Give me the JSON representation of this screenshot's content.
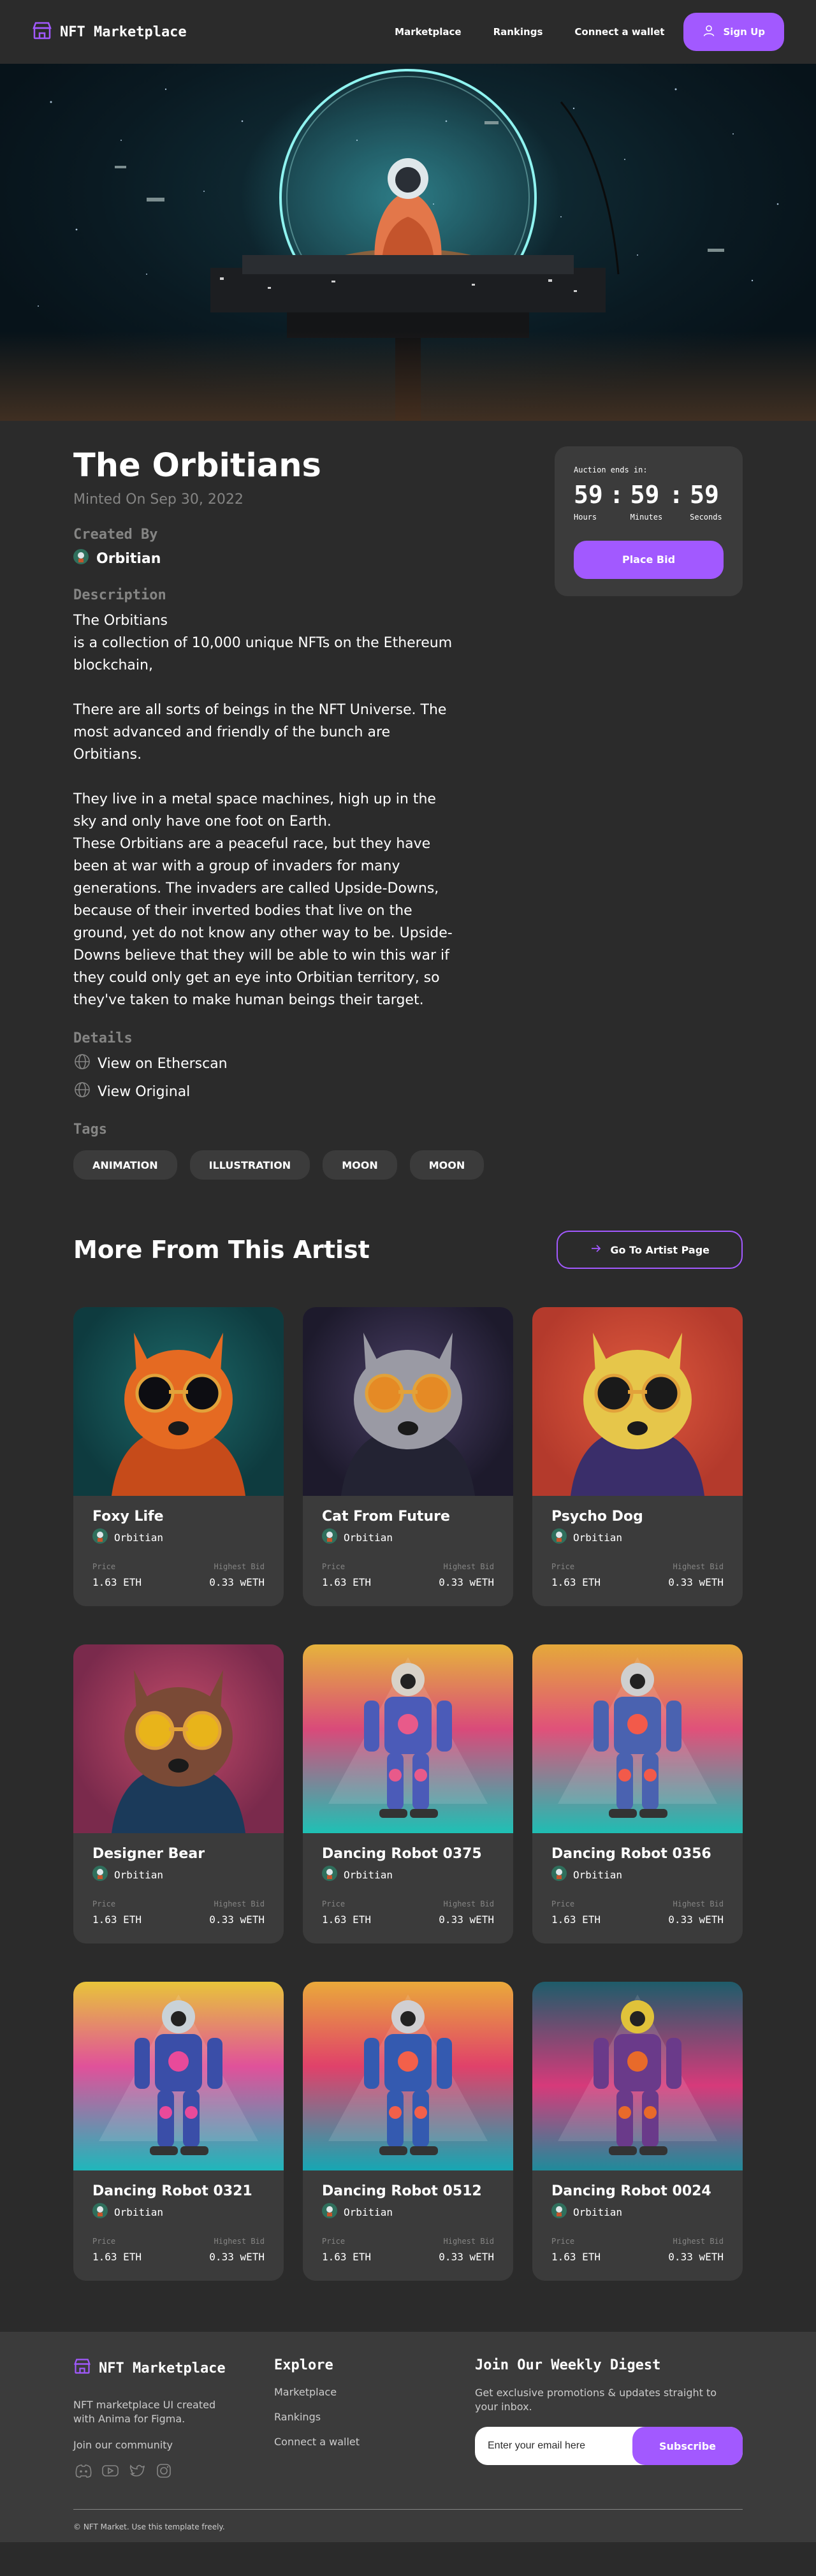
{
  "nav": {
    "brand": "NFT Marketplace",
    "links": [
      "Marketplace",
      "Rankings",
      "Connect a wallet"
    ],
    "signup": "Sign Up"
  },
  "nft": {
    "title": "The Orbitians",
    "minted": "Minted On Sep 30, 2022",
    "created_by_label": "Created By",
    "creator": "Orbitian",
    "description_label": "Description",
    "description": "The Orbitians\nis a collection of 10,000 unique NFTs on the Ethereum blockchain,\n\nThere are all sorts of beings in the NFT Universe. The most advanced and friendly of the bunch are Orbitians.\n\nThey live in a metal space machines, high up in the sky and only have one foot on Earth.\nThese Orbitians are a peaceful race, but they have been at war with a group of invaders for many generations. The invaders are called Upside-Downs, because of their inverted bodies that live on the ground, yet do not know any other way to be. Upside-Downs believe that they will be able to win this war if they could only get an eye into Orbitian territory, so they've taken to make human beings their target.",
    "details_label": "Details",
    "details": [
      "View on Etherscan",
      "View Original"
    ],
    "tags_label": "Tags",
    "tags": [
      "ANIMATION",
      "ILLUSTRATION",
      "MOON",
      "MOON"
    ]
  },
  "auction": {
    "label": "Auction ends in:",
    "hours": "59",
    "minutes": "59",
    "seconds": "59",
    "hours_label": "Hours",
    "minutes_label": "Minutes",
    "seconds_label": "Seconds",
    "button": "Place Bid"
  },
  "more": {
    "title": "More From This Artist",
    "goto": "Go To Artist Page",
    "price_label": "Price",
    "bid_label": "Highest Bid",
    "cards": [
      {
        "name": "Foxy Life",
        "artist": "Orbitian",
        "price": "1.63 ETH",
        "bid": "0.33 wETH",
        "palette": "fox"
      },
      {
        "name": "Cat From Future",
        "artist": "Orbitian",
        "price": "1.63 ETH",
        "bid": "0.33 wETH",
        "palette": "cat"
      },
      {
        "name": "Psycho Dog",
        "artist": "Orbitian",
        "price": "1.63 ETH",
        "bid": "0.33 wETH",
        "palette": "dog"
      },
      {
        "name": "Designer Bear",
        "artist": "Orbitian",
        "price": "1.63 ETH",
        "bid": "0.33 wETH",
        "palette": "bear"
      },
      {
        "name": "Dancing Robot 0375",
        "artist": "Orbitian",
        "price": "1.63 ETH",
        "bid": "0.33 wETH",
        "palette": "robot1"
      },
      {
        "name": "Dancing Robot 0356",
        "artist": "Orbitian",
        "price": "1.63 ETH",
        "bid": "0.33 wETH",
        "palette": "robot2"
      },
      {
        "name": "Dancing Robot 0321",
        "artist": "Orbitian",
        "price": "1.63 ETH",
        "bid": "0.33 wETH",
        "palette": "robot3"
      },
      {
        "name": "Dancing Robot 0512",
        "artist": "Orbitian",
        "price": "1.63 ETH",
        "bid": "0.33 wETH",
        "palette": "robot4"
      },
      {
        "name": "Dancing Robot 0024",
        "artist": "Orbitian",
        "price": "1.63 ETH",
        "bid": "0.33 wETH",
        "palette": "robot5"
      }
    ]
  },
  "footer": {
    "brand": "NFT Marketplace",
    "tagline": "NFT marketplace UI created with Anima for Figma.",
    "community": "Join our community",
    "explore_title": "Explore",
    "explore_links": [
      "Marketplace",
      "Rankings",
      "Connect a wallet"
    ],
    "digest_title": "Join Our Weekly Digest",
    "digest_text": "Get exclusive promotions & updates straight to your inbox.",
    "email_placeholder": "Enter your email here",
    "subscribe": "Subscribe",
    "copyright": "© NFT Market. Use this template freely."
  },
  "colors": {
    "accent": "#a259ff",
    "bg": "#2b2b2b",
    "card": "#3b3b3b",
    "muted": "#858584"
  }
}
